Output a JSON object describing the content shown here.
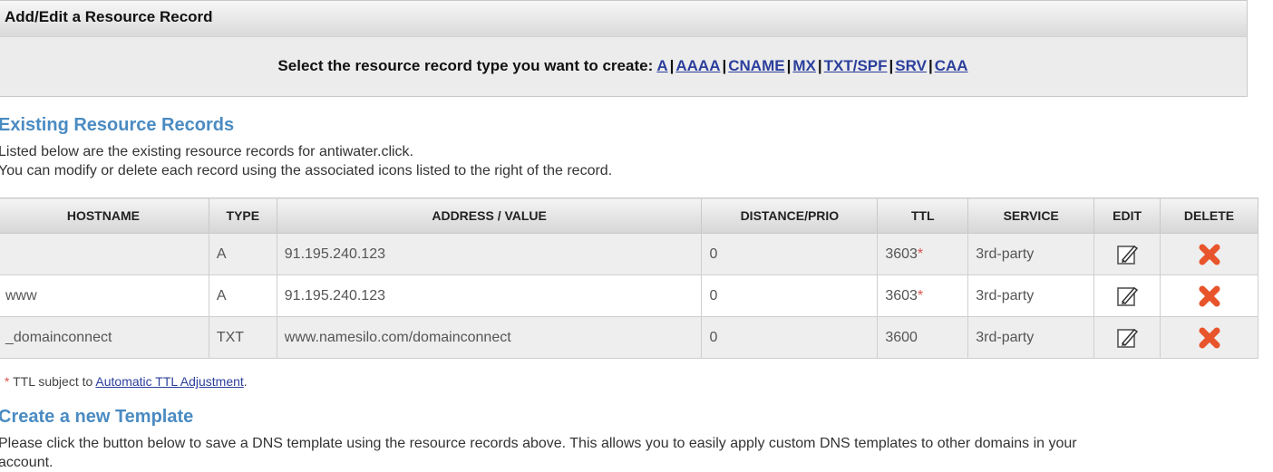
{
  "panel": {
    "title": "Add/Edit a Resource Record",
    "prompt": "Select the resource record type you want to create:",
    "types": [
      "A",
      "AAAA",
      "CNAME",
      "MX",
      "TXT/SPF",
      "SRV",
      "CAA"
    ]
  },
  "existing": {
    "heading": "Existing Resource Records",
    "line1": "Listed below are the existing resource records for antiwater.click.",
    "line2": "You can modify or delete each record using the associated icons listed to the right of the record."
  },
  "table": {
    "headers": [
      "HOSTNAME",
      "TYPE",
      "ADDRESS / VALUE",
      "DISTANCE/PRIO",
      "TTL",
      "SERVICE",
      "EDIT",
      "DELETE"
    ],
    "rows": [
      {
        "hostname": "",
        "type": "A",
        "value": "91.195.240.123",
        "prio": "0",
        "ttl": "3603",
        "ttl_star": "*",
        "service": "3rd-party"
      },
      {
        "hostname": "www",
        "type": "A",
        "value": "91.195.240.123",
        "prio": "0",
        "ttl": "3603",
        "ttl_star": "*",
        "service": "3rd-party"
      },
      {
        "hostname": "_domainconnect",
        "type": "TXT",
        "value": "www.namesilo.com/domainconnect",
        "prio": "0",
        "ttl": "3600",
        "ttl_star": "",
        "service": "3rd-party"
      }
    ]
  },
  "note": {
    "star": "*",
    "prefix": " TTL subject to ",
    "link": "Automatic TTL Adjustment",
    "suffix": "."
  },
  "template": {
    "heading": "Create a new Template",
    "text": "Please click the button below to save a DNS template using the resource records above. This allows you to easily apply custom DNS templates to other domains in your",
    "text2": "account."
  },
  "colors": {
    "heading": "#4a8bc2",
    "link": "#2b3f9c",
    "delete": "#e8542b",
    "star": "#d9534f"
  }
}
